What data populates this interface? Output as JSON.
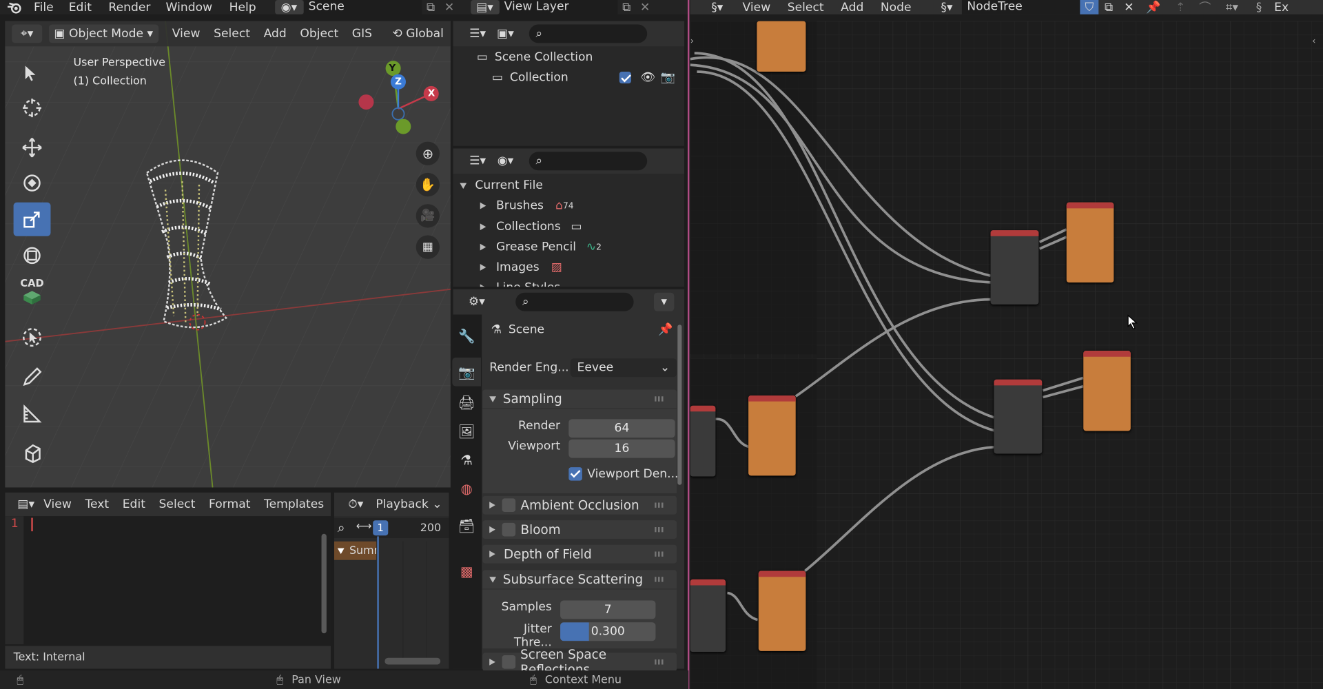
{
  "topbar": {
    "menus": [
      "File",
      "Edit",
      "Render",
      "Window",
      "Help"
    ],
    "scene_label": "Scene",
    "view_layer_label": "View Layer"
  },
  "viewport": {
    "mode": "Object Mode",
    "menus": [
      "View",
      "Select",
      "Add",
      "Object",
      "GIS"
    ],
    "orientation": "Global",
    "info_line1": "User Perspective",
    "info_line2": "(1) Collection",
    "gizmo": {
      "y": "Y",
      "z": "Z",
      "x": "X"
    },
    "cad_label": "CAD"
  },
  "outliner": {
    "scene_collection": "Scene Collection",
    "collection": "Collection"
  },
  "file_browser": {
    "root": "Current File",
    "items": [
      {
        "label": "Brushes",
        "count": "74"
      },
      {
        "label": "Collections",
        "count": ""
      },
      {
        "label": "Grease Pencil",
        "count": "2"
      },
      {
        "label": "Images",
        "count": ""
      },
      {
        "label": "Line Styles",
        "count": ""
      }
    ]
  },
  "properties": {
    "context": "Scene",
    "render_engine_label": "Render Eng...",
    "render_engine_value": "Eevee",
    "sampling_label": "Sampling",
    "render_label": "Render",
    "render_value": "64",
    "viewport_label": "Viewport",
    "viewport_value": "16",
    "viewport_denoise_label": "Viewport Den...",
    "panels": [
      "Ambient Occlusion",
      "Bloom",
      "Depth of Field"
    ],
    "sss_label": "Subsurface Scattering",
    "samples_label": "Samples",
    "samples_value": "7",
    "jitter_label": "Jitter Thre...",
    "jitter_value": "0.300",
    "jitter_fraction": 0.3,
    "ssr_label": "Screen Space Reflections"
  },
  "text_editor": {
    "menus": [
      "View",
      "Text",
      "Edit",
      "Select",
      "Format",
      "Templates"
    ],
    "line_number": "1",
    "footer": "Text: Internal"
  },
  "timeline": {
    "playback": "Playback",
    "current_frame": "1",
    "end_frame": "200",
    "summary": "Summary"
  },
  "node_editor": {
    "menus": [
      "View",
      "Select",
      "Add",
      "Node"
    ],
    "tree_name": "NodeTree",
    "ex_label": "Ex"
  },
  "statusbar": {
    "pan": "Pan View",
    "context_menu": "Context Menu"
  },
  "colors": {
    "accent": "#4772b3",
    "node_header_red": "#b13b3b",
    "node_body_orange": "#c87d3c",
    "wire": "#a5a5a5"
  }
}
